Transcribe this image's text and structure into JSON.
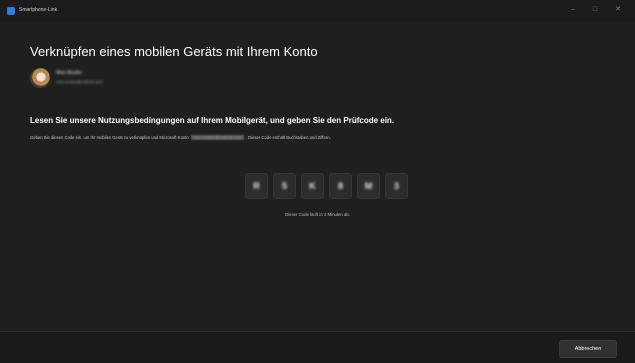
{
  "window": {
    "title": "Smartphone-Link",
    "minimize_glyph": "–",
    "maximize_glyph": "□",
    "close_glyph": "✕"
  },
  "main": {
    "title": "Verknüpfen eines mobilen Geräts mit Ihrem Konto",
    "account": {
      "name": "Max Muster",
      "email": "max.muster@outlook.com"
    },
    "subheading": "Lesen Sie unsere Nutzungsbedingungen auf Ihrem Mobilgerät, und geben Sie den Prüfcode ein.",
    "instructions_before": "Geben Sie diesen Code ein, um Ihr mobiles Gerät zu verknüpfen und Microsoft-Konto",
    "instructions_email": "max.muster@outlook.com",
    "instructions_after": ". Dieser Code enthält Buchstaben und Ziffern.",
    "code": [
      "R",
      "5",
      "K",
      "8",
      "M",
      "3"
    ],
    "expiry_note": "Dieser Code läuft in 3 Minuten ab."
  },
  "footer": {
    "cancel_label": "Abbrechen"
  },
  "colors": {
    "background": "#1f1f1f",
    "titlebar": "#1c1c1c",
    "code_box": "#2c2c2c",
    "app_icon": "#2f7fd6"
  }
}
